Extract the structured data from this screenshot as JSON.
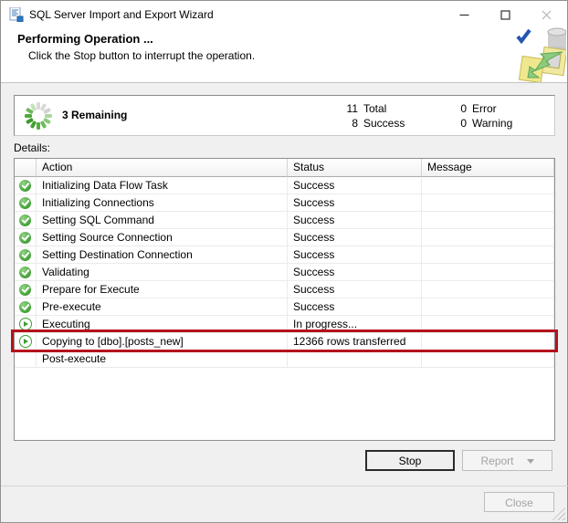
{
  "titlebar": {
    "title": "SQL Server Import and Export Wizard"
  },
  "header": {
    "title": "Performing Operation ...",
    "subtitle": "Click the Stop button to interrupt the operation."
  },
  "summary": {
    "remaining": "3 Remaining",
    "stats": [
      {
        "value": "11",
        "label": "Total"
      },
      {
        "value": "8",
        "label": "Success"
      },
      {
        "value": "0",
        "label": "Error"
      },
      {
        "value": "0",
        "label": "Warning"
      }
    ]
  },
  "details": {
    "label": "Details:",
    "columns": {
      "action": "Action",
      "status": "Status",
      "message": "Message"
    },
    "rows": [
      {
        "icon": "success",
        "action": "Initializing Data Flow Task",
        "status": "Success",
        "message": "",
        "highlighted": false
      },
      {
        "icon": "success",
        "action": "Initializing Connections",
        "status": "Success",
        "message": "",
        "highlighted": false
      },
      {
        "icon": "success",
        "action": "Setting SQL Command",
        "status": "Success",
        "message": "",
        "highlighted": false
      },
      {
        "icon": "success",
        "action": "Setting Source Connection",
        "status": "Success",
        "message": "",
        "highlighted": false
      },
      {
        "icon": "success",
        "action": "Setting Destination Connection",
        "status": "Success",
        "message": "",
        "highlighted": false
      },
      {
        "icon": "success",
        "action": "Validating",
        "status": "Success",
        "message": "",
        "highlighted": false
      },
      {
        "icon": "success",
        "action": "Prepare for Execute",
        "status": "Success",
        "message": "",
        "highlighted": false
      },
      {
        "icon": "success",
        "action": "Pre-execute",
        "status": "Success",
        "message": "",
        "highlighted": false
      },
      {
        "icon": "running",
        "action": "Executing",
        "status": "In progress...",
        "message": "",
        "highlighted": false
      },
      {
        "icon": "running",
        "action": "Copying to [dbo].[posts_new]",
        "status": "12366 rows transferred",
        "message": "",
        "highlighted": true
      },
      {
        "icon": "none",
        "action": "Post-execute",
        "status": "",
        "message": "",
        "highlighted": false
      }
    ]
  },
  "buttons": {
    "stop": "Stop",
    "report": "Report",
    "close": "Close"
  },
  "colors": {
    "success_green": "#3D9E33",
    "highlight_red": "#B5121B",
    "check_blue": "#2456B0",
    "disabled_text": "#A3A3A3"
  }
}
